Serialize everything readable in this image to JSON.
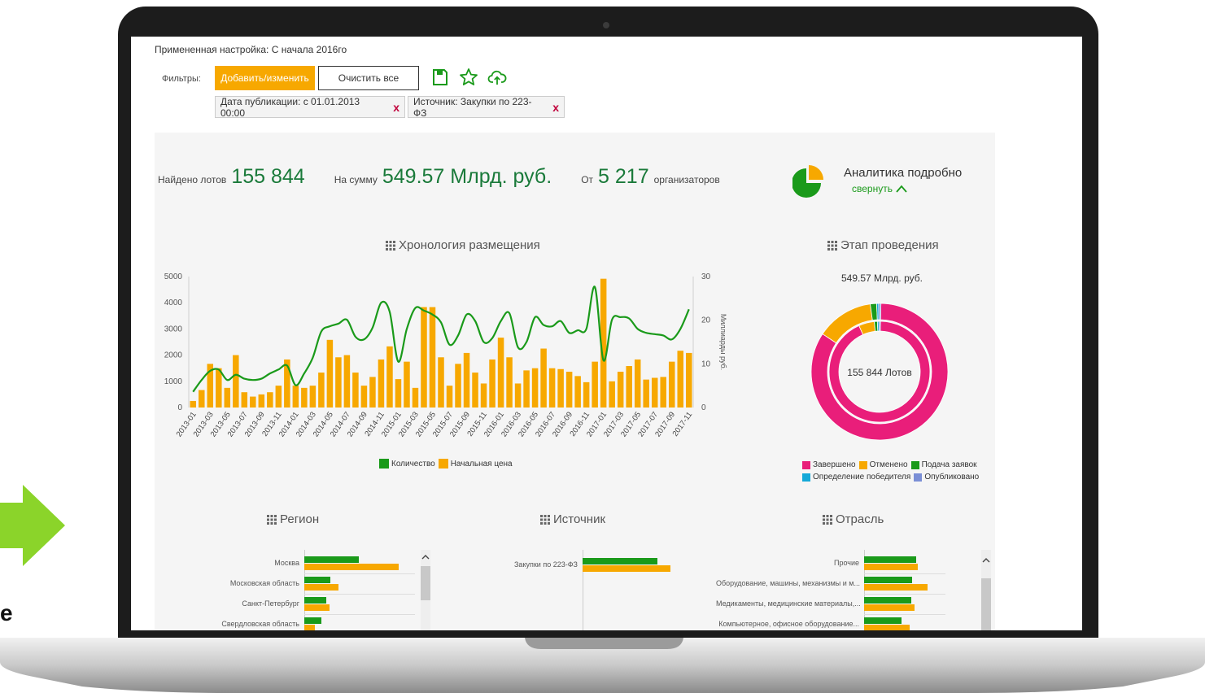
{
  "colors": {
    "accent_orange": "#f7a800",
    "green": "#1a9a1a",
    "dark_green": "#1a7a3a",
    "pink": "#e91e7a",
    "cyan": "#15a9d8",
    "lavender": "#7b8fd6",
    "remove_red": "#c0003b",
    "arrow_green": "#8bd42a"
  },
  "side": {
    "letter": "e"
  },
  "header": {
    "applied_setting": "Примененная настройка: С начала 2016го",
    "filters_label": "Фильтры:",
    "add_button": "Добавить/изменить",
    "clear_button": "Очистить все",
    "icons": [
      "save-icon",
      "star-icon",
      "cloud-upload-icon"
    ]
  },
  "chips": [
    {
      "label": "Дата публикации: с 01.01.2013 00:00",
      "remove": "x"
    },
    {
      "label": "Источник: Закупки по 223-ФЗ",
      "remove": "x"
    }
  ],
  "stats": {
    "lots_label": "Найдено лотов",
    "lots_value": "155 844",
    "sum_label": "На сумму",
    "sum_value": "549.57 Млрд. руб.",
    "from_label": "От",
    "from_value": "5 217",
    "org_label": "организаторов"
  },
  "analytics": {
    "title": "Аналитика подробно",
    "collapse": "свернуть"
  },
  "timeline": {
    "title": "Хронология размещения",
    "legend_count": "Количество",
    "legend_price": "Начальная цена"
  },
  "stage": {
    "title": "Этап проведения",
    "sum_label": "549.57 Млрд. руб.",
    "center_label": "155 844 Лотов",
    "legend": [
      {
        "name": "Завершено",
        "color": "#e91e7a"
      },
      {
        "name": "Отменено",
        "color": "#f7a800"
      },
      {
        "name": "Подача заявок",
        "color": "#1a9a1a"
      },
      {
        "name": "Определение победителя",
        "color": "#15a9d8"
      },
      {
        "name": "Опубликовано",
        "color": "#7b8fd6"
      }
    ]
  },
  "region": {
    "title": "Регион"
  },
  "source": {
    "title": "Источник"
  },
  "industry": {
    "title": "Отрасль"
  },
  "chart_data": [
    {
      "type": "bar",
      "subtype": "combo-bar-line",
      "title": "Хронология размещения",
      "ylabel": "",
      "ylabel_right": "Миллиарды руб.",
      "ylim": [
        0,
        5000
      ],
      "ylim_right": [
        0,
        30
      ],
      "yticks": [
        "0",
        "1000",
        "2000",
        "3000",
        "4000",
        "5000"
      ],
      "yticks_right": [
        "0",
        "10",
        "20",
        "30"
      ],
      "categories": [
        "2013-01",
        "2013-02",
        "2013-03",
        "2013-04",
        "2013-05",
        "2013-06",
        "2013-07",
        "2013-08",
        "2013-09",
        "2013-10",
        "2013-11",
        "2013-12",
        "2014-01",
        "2014-02",
        "2014-03",
        "2014-04",
        "2014-05",
        "2014-06",
        "2014-07",
        "2014-08",
        "2014-09",
        "2014-10",
        "2014-11",
        "2014-12",
        "2015-01",
        "2015-02",
        "2015-03",
        "2015-04",
        "2015-05",
        "2015-06",
        "2015-07",
        "2015-08",
        "2015-09",
        "2015-10",
        "2015-11",
        "2015-12",
        "2016-01",
        "2016-02",
        "2016-03",
        "2016-04",
        "2016-05",
        "2016-06",
        "2016-07",
        "2016-08",
        "2016-09",
        "2016-10",
        "2016-11",
        "2016-12",
        "2017-01",
        "2017-02",
        "2017-03",
        "2017-04",
        "2017-05",
        "2017-06",
        "2017-07",
        "2017-08",
        "2017-09",
        "2017-10",
        "2017-11"
      ],
      "tick_labels": [
        "2013-01",
        "2013-03",
        "2013-05",
        "2013-07",
        "2013-09",
        "2013-11",
        "2014-01",
        "2014-03",
        "2014-05",
        "2014-07",
        "2014-09",
        "2014-11",
        "2015-01",
        "2015-03",
        "2015-05",
        "2015-07",
        "2015-09",
        "2015-11",
        "2016-01",
        "2016-03",
        "2016-05",
        "2016-07",
        "2016-09",
        "2016-11",
        "2017-01",
        "2017-03",
        "2017-05",
        "2017-07",
        "2017-09",
        "2017-11"
      ],
      "series": [
        {
          "name": "Начальная цена",
          "axis": "right",
          "color": "#f7a800",
          "values": [
            1.5,
            4,
            10,
            9,
            4.5,
            12,
            3.5,
            2.5,
            3,
            3.5,
            5,
            11,
            5,
            4.5,
            5,
            8,
            15.5,
            11.5,
            12,
            8,
            5,
            7,
            11,
            14,
            6.5,
            10.5,
            4.5,
            23,
            23,
            11.5,
            5,
            10,
            12.5,
            8,
            5.5,
            11,
            16,
            11.5,
            5.5,
            8.5,
            9,
            13.5,
            9,
            8.8,
            8.2,
            7.2,
            5.8,
            10.5,
            29.5,
            6,
            8.2,
            9.5,
            11,
            6.4,
            6.8,
            7,
            10.5,
            13,
            12.5
          ]
        },
        {
          "name": "Количество",
          "axis": "left",
          "type": "line",
          "color": "#1a9a1a",
          "values": [
            600,
            1050,
            1400,
            1450,
            1050,
            1250,
            1100,
            1050,
            1100,
            1300,
            1450,
            1600,
            850,
            1300,
            1900,
            2900,
            3100,
            3200,
            3350,
            2700,
            2600,
            3050,
            4000,
            3650,
            1750,
            3000,
            3800,
            3700,
            3550,
            3250,
            2400,
            2750,
            3550,
            3300,
            2500,
            2650,
            3300,
            3600,
            2300,
            2500,
            3450,
            3150,
            3100,
            3300,
            2850,
            2950,
            3000,
            4600,
            1800,
            3350,
            3450,
            3400,
            3000,
            2850,
            2800,
            2750,
            2600,
            3000,
            3750
          ]
        }
      ]
    },
    {
      "type": "pie",
      "subtype": "double-donut",
      "title": "Этап проведения",
      "categories": [
        "Завершено",
        "Отменено",
        "Подача заявок",
        "Определение победителя",
        "Опубликовано"
      ],
      "series": [
        {
          "name": "549.57 Млрд. руб.",
          "ring": "outer",
          "values": [
            84,
            13.5,
            1.5,
            0.5,
            0.5
          ]
        },
        {
          "name": "155 844 Лотов",
          "ring": "inner",
          "values": [
            93,
            5,
            1,
            0.5,
            0.5
          ]
        }
      ]
    },
    {
      "type": "bar",
      "orientation": "horizontal",
      "title": "Регион",
      "categories": [
        "Москва",
        "Московская область",
        "Санкт-Петербург",
        "Свердловская область"
      ],
      "series": [
        {
          "name": "Количество",
          "values": [
            0.58,
            0.28,
            0.23,
            0.18
          ]
        },
        {
          "name": "Начальная цена",
          "values": [
            1.0,
            0.36,
            0.27,
            0.11
          ]
        }
      ],
      "xlim": [
        0,
        1
      ]
    },
    {
      "type": "bar",
      "orientation": "horizontal",
      "title": "Источник",
      "categories": [
        "Закупки по 223-ФЗ"
      ],
      "series": [
        {
          "name": "Количество",
          "values": [
            0.85
          ]
        },
        {
          "name": "Начальная цена",
          "values": [
            1.0
          ]
        }
      ],
      "xlim": [
        0,
        1
      ]
    },
    {
      "type": "bar",
      "orientation": "horizontal",
      "title": "Отрасль",
      "categories": [
        "Прочие",
        "Оборудование, машины, механизмы и м...",
        "Медикаменты, медицинские материалы,...",
        "Компьютерное, офисное оборудование..."
      ],
      "series": [
        {
          "name": "Количество",
          "values": [
            0.8,
            0.74,
            0.73,
            0.58
          ]
        },
        {
          "name": "Начальная цена",
          "values": [
            0.82,
            0.97,
            0.77,
            0.7
          ]
        }
      ],
      "xlim": [
        0,
        1
      ]
    }
  ]
}
